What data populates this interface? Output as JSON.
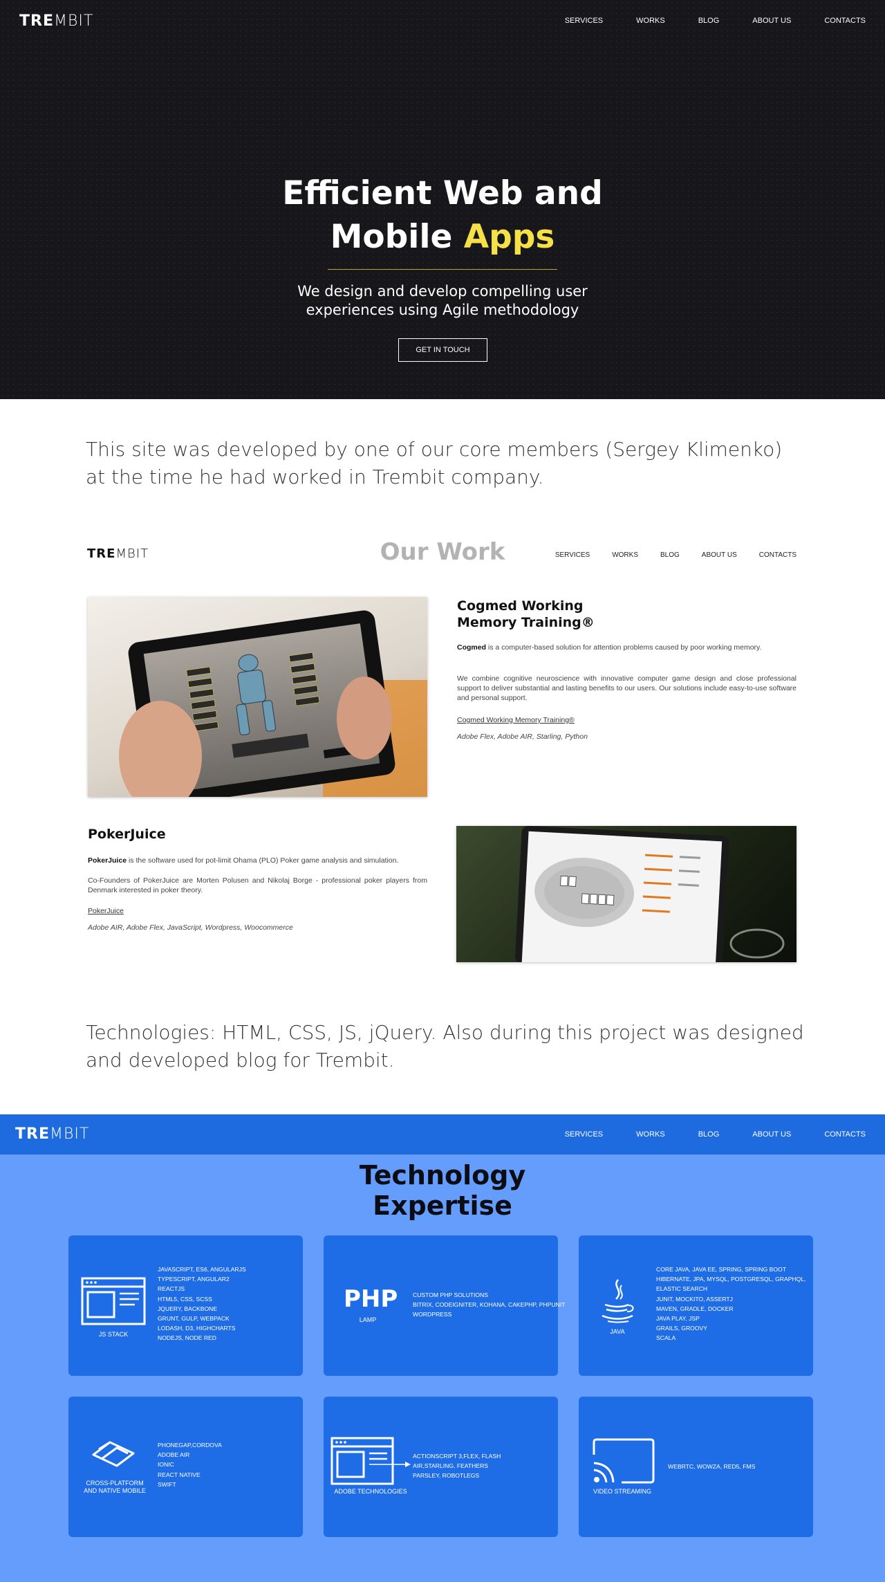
{
  "brand": {
    "logo_bold": "TRE",
    "logo_light": "MBIT"
  },
  "nav": [
    "SERVICES",
    "WORKS",
    "BLOG",
    "ABOUT US",
    "CONTACTS"
  ],
  "hero": {
    "title_line1": "Efficient Web and",
    "title_line2_a": "Mobile ",
    "title_line2_b": "Apps",
    "subtitle_line1": "We design and develop compelling user",
    "subtitle_line2": "experiences using Agile methodology",
    "cta": "GET IN TOUCH"
  },
  "intro_text": "This site was developed by one of our core members (Sergey Klimenko) at the time he had worked in Trembit company.",
  "work": {
    "title": "Our Work",
    "projects": [
      {
        "title_line1": "Cogmed Working",
        "title_line2": "Memory Training®",
        "p1_bold": "Cogmed",
        "p1_rest": " is a computer-based solution for attention problems caused by poor working memory.",
        "p2": "We combine cognitive neuroscience with innovative computer game design and close professional support to deliver substantial and lasting benefits to our users. Our solutions include easy-to-use software and personal support.",
        "link": "Cogmed Working Memory Training®",
        "tech": "Adobe Flex, Adobe AIR, Starling, Python"
      },
      {
        "title_line1": "PokerJuice",
        "p1_bold": "PokerJuice",
        "p1_rest": " is the software used for pot-limit Ohama (PLO) Poker game analysis and simulation.",
        "p2": "Co-Founders of PokerJuice are Morten Polusen and Nikolaj Borge - professional poker players from Denmark interested in poker theory.",
        "link": "PokerJuice",
        "tech": "Adobe AIR, Adobe Flex, JavaScript, Wordpress, Woocommerce"
      }
    ]
  },
  "technologies_text": "Technologies: HTML, CSS, JS, jQuery. Also during this project was designed and developed blog for Trembit.",
  "tech": {
    "title_line1": "Technology",
    "title_line2": "Expertise",
    "cards": [
      {
        "caption": "JS STACK",
        "icon": "browser-window-icon",
        "items": [
          "JAVASCRIPT, ES6, ANGULARJS",
          "TYPESCRIPT, ANGULAR2",
          "REACTJS",
          "HTML5, CSS, SCSS",
          "JQUERY, BACKBONE",
          "GRUNT, GULP, WEBPACK",
          "LODASH, D3, HIGHCHARTS",
          "NODEJS, NODE RED"
        ]
      },
      {
        "caption": "LAMP",
        "icon": "php-logo",
        "logo_text": "PHP",
        "items": [
          "CUSTOM PHP SOLUTIONS",
          "BITRIX, CODEIGNITER, KOHANA, CAKEPHP, PHPUNIT",
          "WORDPRESS"
        ]
      },
      {
        "caption": "JAVA",
        "icon": "java-cup-icon",
        "items": [
          "CORE JAVA, JAVA EE, SPRING, SPRING BOOT",
          "HIBERNATE, JPA, MYSQL, POSTGRESQL, GRAPHQL,",
          "ELASTIC SEARCH",
          "JUNIT, MOCKITO, ASSERTJ",
          "MAVEN, GRADLE, DOCKER",
          "JAVA PLAY, JSP",
          "GRAILS, GROOVY",
          "SCALA"
        ]
      },
      {
        "caption_line1": "CROSS-PLATFORM",
        "caption_line2": "AND NATIVE MOBILE",
        "icon": "stacked-layers-icon",
        "items": [
          "PHONEGAP,CORDOVA",
          "ADOBE AIR",
          "IONIC",
          "REACT NATIVE",
          "SWIFT"
        ]
      },
      {
        "caption": "ADOBE TECHNOLOGIES",
        "icon": "flash-window-icon",
        "items": [
          "ACTIONSCRIPT 3,FLEX, FLASH",
          "AIR,STARLING, FEATHERS",
          "PARSLEY, ROBOTLEGS"
        ]
      },
      {
        "caption": "VIDEO STREAMING",
        "icon": "cast-icon",
        "items": [
          "WEBRTC, WOWZA, RED5, FMS"
        ]
      }
    ]
  },
  "colors": {
    "hero_bg": "#16161b",
    "accent_yellow": "#f5e047",
    "tech_bar": "#1e6be0",
    "tech_bg": "#649dfb",
    "card_bg": "#1e6de6"
  }
}
